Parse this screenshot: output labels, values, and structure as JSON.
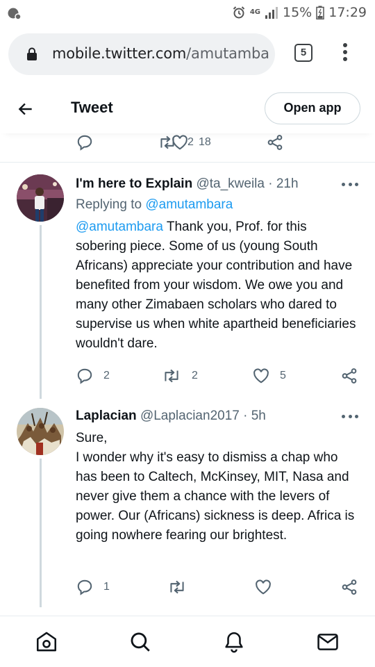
{
  "status_bar": {
    "battery_percent": "15%",
    "time": "17:29",
    "network": "4G"
  },
  "browser": {
    "url_host": "mobile.twitter.com",
    "url_path": "/amutamba",
    "tab_count": "5"
  },
  "header": {
    "title": "Tweet",
    "open_app_label": "Open app"
  },
  "previous_tweet_actions": {
    "retweets": "2",
    "likes": "18"
  },
  "tweets": [
    {
      "name": "I'm here to Explain",
      "handle": "@ta_kweila",
      "time": "· 21h",
      "replying_label": "Replying to",
      "replying_handle": "@amutambara",
      "mention": "@amutambara",
      "text": " Thank you, Prof. for this sobering piece. Some of us (young South Africans) appreciate your contribution and have benefited from your wisdom. We owe you and many other Zimabaen scholars who dared to supervise us when white apartheid beneficiaries wouldn't dare.",
      "replies": "2",
      "retweets": "2",
      "likes": "5"
    },
    {
      "name": "Laplacian",
      "handle": "@Laplacian2017",
      "time": "· 5h",
      "text": "Sure,\nI wonder why it's easy to dismiss a chap who has been to Caltech, McKinsey, MIT, Nasa and never give them a chance with the levers of power. Our (Africans) sickness is deep. Africa is going nowhere  fearing our brightest.",
      "replies": "1"
    }
  ],
  "bottom_nav": [
    "home-icon",
    "search-icon",
    "notifications-icon",
    "messages-icon"
  ],
  "colors": {
    "link": "#1d9bf0",
    "text": "#0f1419",
    "secondary": "#536471",
    "divider": "#e6ecf0"
  }
}
